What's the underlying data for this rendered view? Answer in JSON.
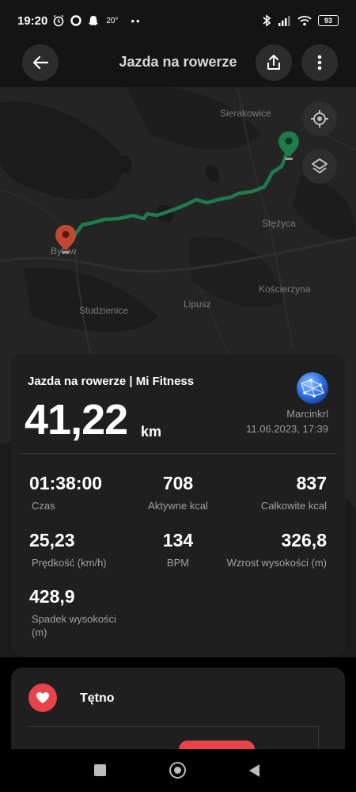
{
  "status_bar": {
    "time": "19:20",
    "temperature": "20°",
    "dots": "••",
    "battery": "93"
  },
  "header": {
    "title": "Jazda na rowerze",
    "icons": [
      "back-arrow-icon",
      "share-icon",
      "more-icon"
    ]
  },
  "map": {
    "place_labels": [
      {
        "name": "Sierakowice"
      },
      {
        "name": "Stężyca"
      },
      {
        "name": "Bytów"
      },
      {
        "name": "Kościerzyna"
      },
      {
        "name": "Studzienice"
      },
      {
        "name": "Lipusz"
      }
    ],
    "controls": [
      "locate-icon",
      "layers-icon"
    ],
    "route_color": "#1f7a4d",
    "start_pin_color": "#c2482f",
    "end_pin_color": "#1f7a4d"
  },
  "summary": {
    "title": "Jazda na rowerze | Mi Fitness",
    "distance": "41,22",
    "unit": "km",
    "username": "Marcinkrl",
    "datetime": "11.06.2023, 17:39"
  },
  "stats": [
    {
      "value": "01:38:00",
      "label": "Czas"
    },
    {
      "value": "708",
      "label": "Aktywne kcal"
    },
    {
      "value": "837",
      "label": "Całkowite kcal"
    },
    {
      "value": "25,23",
      "label": "Prędkość (km/h)"
    },
    {
      "value": "134",
      "label": "BPM"
    },
    {
      "value": "326,8",
      "label": "Wzrost wysokości (m)"
    },
    {
      "value": "428,9",
      "label": "Spadek wysokości (m)"
    }
  ],
  "heart_card": {
    "title": "Tętno",
    "accent": "#e8424a"
  },
  "navbar": {
    "buttons": [
      "recents-button",
      "home-button",
      "back-button"
    ]
  }
}
